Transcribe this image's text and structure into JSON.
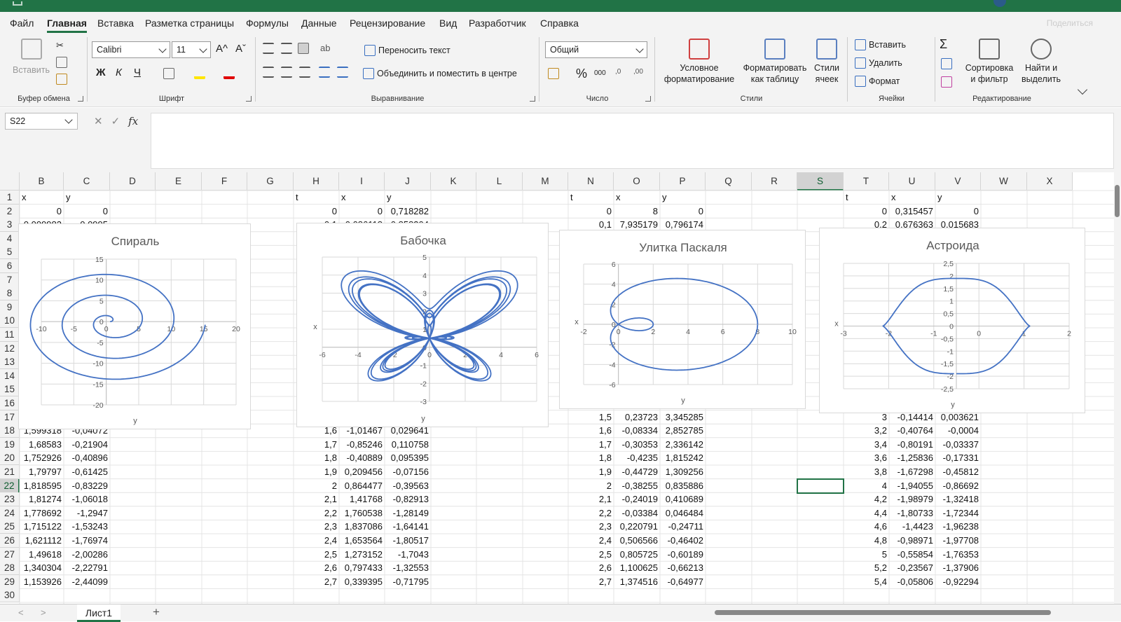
{
  "colors": {
    "accent": "#217346",
    "series": "#4472C4"
  },
  "menu": {
    "items": [
      "Файл",
      "Главная",
      "Вставка",
      "Разметка страницы",
      "Формулы",
      "Данные",
      "Рецензирование",
      "Вид",
      "Разработчик",
      "Справка"
    ],
    "active": 1,
    "share": "Поделиться"
  },
  "ribbon": {
    "clipboard": {
      "paste": "Вставить",
      "label": "Буфер обмена"
    },
    "font": {
      "name": "Calibri",
      "size": "11",
      "bold": "Ж",
      "italic": "К",
      "underline": "Ч",
      "label": "Шрифт",
      "grow": "A^",
      "shrink": "Aˇ"
    },
    "alignment": {
      "wrap": "Переносить текст",
      "merge": "Объединить и поместить в центре",
      "label": "Выравнивание"
    },
    "number": {
      "format": "Общий",
      "percent": "%",
      "thousands": "000",
      "label": "Число"
    },
    "styles": {
      "conditional": "Условное форматирование",
      "table": "Форматировать как таблицу",
      "cell": "Стили ячеек",
      "label": "Стили"
    },
    "cells": {
      "insert": "Вставить",
      "delete": "Удалить",
      "format": "Формат",
      "label": "Ячейки"
    },
    "editing": {
      "sort": "Сортировка и фильтр",
      "find": "Найти и выделить",
      "label": "Редактирование",
      "sigma": "Σ"
    }
  },
  "formula": {
    "namebox": "S22",
    "fx": "fx",
    "value": ""
  },
  "columns": [
    "B",
    "C",
    "D",
    "E",
    "F",
    "G",
    "H",
    "I",
    "J",
    "K",
    "L",
    "M",
    "N",
    "O",
    "P",
    "Q",
    "R",
    "S",
    "T",
    "U",
    "V",
    "W",
    "X"
  ],
  "selected": {
    "column": "S",
    "row": "22"
  },
  "rows": [
    "1",
    "2",
    "3",
    "4",
    "5",
    "6",
    "7",
    "8",
    "9",
    "10",
    "11",
    "12",
    "13",
    "14",
    "15",
    "16",
    "17",
    "18",
    "19",
    "20",
    "21",
    "22",
    "23",
    "24",
    "25",
    "26",
    "27",
    "28",
    "29",
    "30"
  ],
  "cells": [
    [
      "B1",
      "x"
    ],
    [
      "C1",
      "y"
    ],
    [
      "H1",
      "t"
    ],
    [
      "I1",
      "x"
    ],
    [
      "J1",
      "y"
    ],
    [
      "N1",
      "t"
    ],
    [
      "O1",
      "x"
    ],
    [
      "P1",
      "y"
    ],
    [
      "T1",
      "t"
    ],
    [
      "U1",
      "x"
    ],
    [
      "V1",
      "y"
    ],
    [
      "B2",
      "0"
    ],
    [
      "C2",
      "0"
    ],
    [
      "H2",
      "0"
    ],
    [
      "I2",
      "0"
    ],
    [
      "J2",
      "0,718282"
    ],
    [
      "N2",
      "0"
    ],
    [
      "O2",
      "8"
    ],
    [
      "P2",
      "0"
    ],
    [
      "T2",
      "0"
    ],
    [
      "U2",
      "0,315457"
    ],
    [
      "V2",
      "0"
    ],
    [
      "B3",
      "0,009983"
    ],
    [
      "C3",
      "0,0995"
    ],
    [
      "H3",
      "0,1"
    ],
    [
      "I3",
      "0,086118"
    ],
    [
      "J3",
      "0,858304"
    ],
    [
      "N3",
      "0,1"
    ],
    [
      "O3",
      "7,935179"
    ],
    [
      "P3",
      "0,796174"
    ],
    [
      "T3",
      "0,2"
    ],
    [
      "U3",
      "0,676363"
    ],
    [
      "V3",
      "0,015683"
    ],
    [
      "N17",
      "1,5"
    ],
    [
      "O17",
      "0,23723"
    ],
    [
      "P17",
      "3,345285"
    ],
    [
      "T17",
      "3"
    ],
    [
      "U17",
      "-0,14414"
    ],
    [
      "V17",
      "0,003621"
    ],
    [
      "B18",
      "1,599318"
    ],
    [
      "C18",
      "-0,04072"
    ],
    [
      "H18",
      "1,6"
    ],
    [
      "I18",
      "-1,01467"
    ],
    [
      "J18",
      "0,029641"
    ],
    [
      "N18",
      "1,6"
    ],
    [
      "O18",
      "-0,08334"
    ],
    [
      "P18",
      "2,852785"
    ],
    [
      "T18",
      "3,2"
    ],
    [
      "U18",
      "-0,40764"
    ],
    [
      "V18",
      "-0,0004"
    ],
    [
      "B19",
      "1,68583"
    ],
    [
      "C19",
      "-0,21904"
    ],
    [
      "H19",
      "1,7"
    ],
    [
      "I19",
      "-0,85246"
    ],
    [
      "J19",
      "0,110758"
    ],
    [
      "N19",
      "1,7"
    ],
    [
      "O19",
      "-0,30353"
    ],
    [
      "P19",
      "2,336142"
    ],
    [
      "T19",
      "3,4"
    ],
    [
      "U19",
      "-0,80191"
    ],
    [
      "V19",
      "-0,03337"
    ],
    [
      "B20",
      "1,752926"
    ],
    [
      "C20",
      "-0,40896"
    ],
    [
      "H20",
      "1,8"
    ],
    [
      "I20",
      "-0,40889"
    ],
    [
      "J20",
      "0,095395"
    ],
    [
      "N20",
      "1,8"
    ],
    [
      "O20",
      "-0,4235"
    ],
    [
      "P20",
      "1,815242"
    ],
    [
      "T20",
      "3,6"
    ],
    [
      "U20",
      "-1,25836"
    ],
    [
      "V20",
      "-0,17331"
    ],
    [
      "B21",
      "1,79797"
    ],
    [
      "C21",
      "-0,61425"
    ],
    [
      "H21",
      "1,9"
    ],
    [
      "I21",
      "0,209456"
    ],
    [
      "J21",
      "-0,07156"
    ],
    [
      "N21",
      "1,9"
    ],
    [
      "O21",
      "-0,44729"
    ],
    [
      "P21",
      "1,309256"
    ],
    [
      "T21",
      "3,8"
    ],
    [
      "U21",
      "-1,67298"
    ],
    [
      "V21",
      "-0,45812"
    ],
    [
      "B22",
      "1,818595"
    ],
    [
      "C22",
      "-0,83229"
    ],
    [
      "H22",
      "2"
    ],
    [
      "I22",
      "0,864477"
    ],
    [
      "J22",
      "-0,39563"
    ],
    [
      "N22",
      "2"
    ],
    [
      "O22",
      "-0,38255"
    ],
    [
      "P22",
      "0,835886"
    ],
    [
      "T22",
      "4"
    ],
    [
      "U22",
      "-1,94055"
    ],
    [
      "V22",
      "-0,86692"
    ],
    [
      "B23",
      "1,81274"
    ],
    [
      "C23",
      "-1,06018"
    ],
    [
      "H23",
      "2,1"
    ],
    [
      "I23",
      "1,41768"
    ],
    [
      "J23",
      "-0,82913"
    ],
    [
      "N23",
      "2,1"
    ],
    [
      "O23",
      "-0,24019"
    ],
    [
      "P23",
      "0,410689"
    ],
    [
      "T23",
      "4,2"
    ],
    [
      "U23",
      "-1,98979"
    ],
    [
      "V23",
      "-1,32418"
    ],
    [
      "B24",
      "1,778692"
    ],
    [
      "C24",
      "-1,2947"
    ],
    [
      "H24",
      "2,2"
    ],
    [
      "I24",
      "1,760538"
    ],
    [
      "J24",
      "-1,28149"
    ],
    [
      "N24",
      "2,2"
    ],
    [
      "O24",
      "-0,03384"
    ],
    [
      "P24",
      "0,046484"
    ],
    [
      "T24",
      "4,4"
    ],
    [
      "U24",
      "-1,80733"
    ],
    [
      "V24",
      "-1,72344"
    ],
    [
      "B25",
      "1,715122"
    ],
    [
      "C25",
      "-1,53243"
    ],
    [
      "H25",
      "2,3"
    ],
    [
      "I25",
      "1,837086"
    ],
    [
      "J25",
      "-1,64141"
    ],
    [
      "N25",
      "2,3"
    ],
    [
      "O25",
      "0,220791"
    ],
    [
      "P25",
      "-0,24711"
    ],
    [
      "T25",
      "4,6"
    ],
    [
      "U25",
      "-1,4423"
    ],
    [
      "V25",
      "-1,96238"
    ],
    [
      "B26",
      "1,621112"
    ],
    [
      "C26",
      "-1,76974"
    ],
    [
      "H26",
      "2,4"
    ],
    [
      "I26",
      "1,653564"
    ],
    [
      "J26",
      "-1,80517"
    ],
    [
      "N26",
      "2,4"
    ],
    [
      "O26",
      "0,506566"
    ],
    [
      "P26",
      "-0,46402"
    ],
    [
      "T26",
      "4,8"
    ],
    [
      "U26",
      "-0,98971"
    ],
    [
      "V26",
      "-1,97708"
    ],
    [
      "B27",
      "1,49618"
    ],
    [
      "C27",
      "-2,00286"
    ],
    [
      "H27",
      "2,5"
    ],
    [
      "I27",
      "1,273152"
    ],
    [
      "J27",
      "-1,7043"
    ],
    [
      "N27",
      "2,5"
    ],
    [
      "O27",
      "0,805725"
    ],
    [
      "P27",
      "-0,60189"
    ],
    [
      "T27",
      "5"
    ],
    [
      "U27",
      "-0,55854"
    ],
    [
      "V27",
      "-1,76353"
    ],
    [
      "B28",
      "1,340304"
    ],
    [
      "C28",
      "-2,22791"
    ],
    [
      "H28",
      "2,6"
    ],
    [
      "I28",
      "0,797433"
    ],
    [
      "J28",
      "-1,32553"
    ],
    [
      "N28",
      "2,6"
    ],
    [
      "O28",
      "1,100625"
    ],
    [
      "P28",
      "-0,66213"
    ],
    [
      "T28",
      "5,2"
    ],
    [
      "U28",
      "-0,23567"
    ],
    [
      "V28",
      "-1,37906"
    ],
    [
      "B29",
      "1,153926"
    ],
    [
      "C29",
      "-2,44099"
    ],
    [
      "H29",
      "2,7"
    ],
    [
      "I29",
      "0,339395"
    ],
    [
      "J29",
      "-0,71795"
    ],
    [
      "N29",
      "2,7"
    ],
    [
      "O29",
      "1,374516"
    ],
    [
      "P29",
      "-0,64977"
    ],
    [
      "T29",
      "5,4"
    ],
    [
      "U29",
      "-0,05806"
    ],
    [
      "V29",
      "-0,92294"
    ]
  ],
  "chart_data": [
    {
      "type": "scatter",
      "title": "Спираль",
      "xlabel": "y",
      "ylabel": "",
      "xlim": [
        -10,
        20
      ],
      "ylim": [
        -20,
        15
      ],
      "xticks": [
        "-10",
        "-5",
        "0",
        "5",
        "10",
        "15",
        "20"
      ],
      "yticks": [
        "15",
        "10",
        "5",
        "0",
        "-5",
        "-10",
        "-15",
        "-20"
      ],
      "curve": "spiral"
    },
    {
      "type": "scatter",
      "title": "Бабочка",
      "xlabel": "y",
      "ylabel": "x",
      "xlim": [
        -6,
        6
      ],
      "ylim": [
        -3,
        5
      ],
      "xticks": [
        "-6",
        "-4",
        "-2",
        "0",
        "2",
        "4",
        "6"
      ],
      "yticks": [
        "5",
        "4",
        "3",
        "2",
        "1",
        "0",
        "-1",
        "-2",
        "-3"
      ],
      "curve": "butterfly"
    },
    {
      "type": "scatter",
      "title": "Улитка Паскаля",
      "xlabel": "y",
      "ylabel": "x",
      "xlim": [
        -2,
        10
      ],
      "ylim": [
        -6,
        6
      ],
      "xticks": [
        "-2",
        "0",
        "2",
        "4",
        "6",
        "8",
        "10"
      ],
      "yticks": [
        "6",
        "4",
        "2",
        "0",
        "-2",
        "-4",
        "-6"
      ],
      "curve": "limacon"
    },
    {
      "type": "scatter",
      "title": "Астроида",
      "xlabel": "y",
      "ylabel": "x",
      "xlim": [
        -3,
        3
      ],
      "ylim": [
        -2.5,
        2.5
      ],
      "xticks": [
        "-3",
        "-2",
        "-1",
        "0",
        "1",
        "2"
      ],
      "yticks": [
        "2,5",
        "2",
        "1,5",
        "1",
        "0,5",
        "0",
        "-0,5",
        "-1",
        "-1,5",
        "-2",
        "-2,5"
      ],
      "curve": "astroid"
    }
  ],
  "sheet": {
    "name": "Лист1",
    "add": "+"
  }
}
